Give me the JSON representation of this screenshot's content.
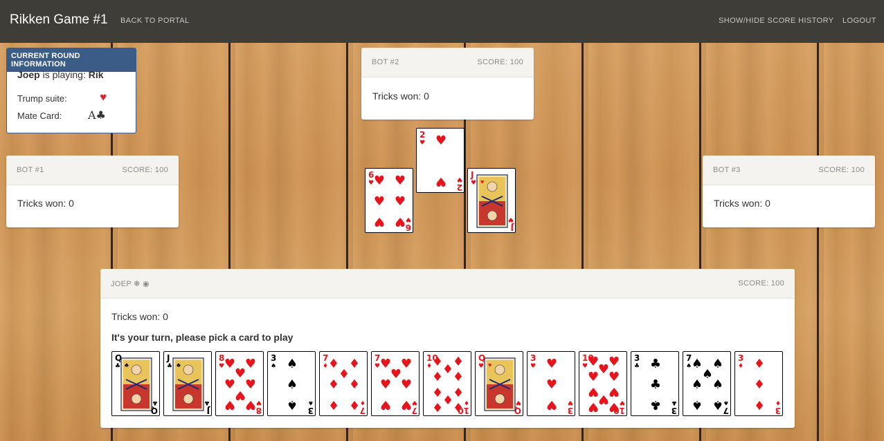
{
  "nav": {
    "brand": "Rikken Game #1",
    "back_link": "BACK TO PORTAL",
    "score_history_link": "SHOW/HIDE SCORE HISTORY",
    "logout_link": "LOGOUT"
  },
  "round_info": {
    "header": "CURRENT ROUND INFORMATION",
    "player": "Joep",
    "is_playing_text": "is playing:",
    "game_type": "Rik",
    "trump_label": "Trump suite:",
    "trump_symbol": "♥",
    "mate_label": "Mate Card:",
    "mate_card": "A♣"
  },
  "bots": [
    {
      "name": "BOT #1",
      "score": "SCORE: 100",
      "tricks": "Tricks won: 0"
    },
    {
      "name": "BOT #2",
      "score": "SCORE: 100",
      "tricks": "Tricks won: 0"
    },
    {
      "name": "BOT #3",
      "score": "SCORE: 100",
      "tricks": "Tricks won: 0"
    }
  ],
  "player": {
    "name": "JOEP ❋ ◉",
    "score": "SCORE: 100",
    "tricks": "Tricks won: 0",
    "turn_message": "It's your turn, please pick a card to play"
  },
  "table_cards": [
    {
      "rank": "6",
      "suit": "♥"
    },
    {
      "rank": "2",
      "suit": "♥"
    },
    {
      "rank": "J",
      "suit": "♥"
    }
  ],
  "hand_cards": [
    {
      "rank": "Q",
      "suit": "♣"
    },
    {
      "rank": "J",
      "suit": "♣"
    },
    {
      "rank": "8",
      "suit": "♥"
    },
    {
      "rank": "3",
      "suit": "♠"
    },
    {
      "rank": "7",
      "suit": "♦"
    },
    {
      "rank": "7",
      "suit": "♥"
    },
    {
      "rank": "10",
      "suit": "♦"
    },
    {
      "rank": "Q",
      "suit": "♥"
    },
    {
      "rank": "3",
      "suit": "♥"
    },
    {
      "rank": "10",
      "suit": "♥"
    },
    {
      "rank": "3",
      "suit": "♣"
    },
    {
      "rank": "7",
      "suit": "♠"
    },
    {
      "rank": "3",
      "suit": "♦"
    }
  ],
  "colors": {
    "navbar": "#3e3d38",
    "info_header": "#3b5c86",
    "red_suit": "#e8141c",
    "black_suit": "#000000"
  }
}
